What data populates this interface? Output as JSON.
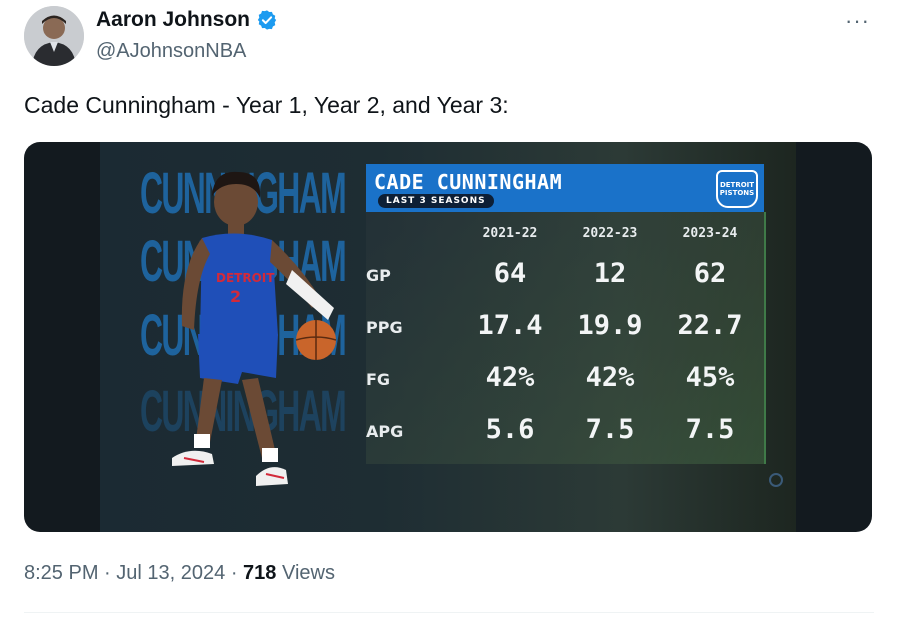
{
  "author": {
    "name": "Aaron Johnson",
    "handle": "@AJohnsonNBA",
    "verified_color": "#1d9bf0"
  },
  "tweet": {
    "text": "Cade Cunningham - Year 1, Year 2, and Year 3:",
    "more_icon": "more-horizontal-icon"
  },
  "graphic": {
    "ghost_text": [
      "CUNNINGHAM",
      "CUNNINGHAM",
      "CUNNINGHAM",
      "CUNNINGHAM"
    ],
    "jersey_text": "DETROIT",
    "jersey_number": "2",
    "title": "CADE CUNNINGHAM",
    "subtitle": "LAST 3 SEASONS",
    "team_logo_line1": "DETROIT",
    "team_logo_line2": "PISTONS",
    "accent_color": "#1a72c9"
  },
  "chart_data": {
    "type": "table",
    "title": "CADE CUNNINGHAM",
    "subtitle": "LAST 3 SEASONS",
    "columns": [
      "2021-22",
      "2022-23",
      "2023-24"
    ],
    "rows": [
      {
        "label": "GP",
        "values": [
          "64",
          "12",
          "62"
        ]
      },
      {
        "label": "PPG",
        "values": [
          "17.4",
          "19.9",
          "22.7"
        ]
      },
      {
        "label": "FG",
        "values": [
          "42%",
          "42%",
          "45%"
        ]
      },
      {
        "label": "APG",
        "values": [
          "5.6",
          "7.5",
          "7.5"
        ]
      }
    ]
  },
  "footer": {
    "time": "8:25 PM",
    "date": "Jul 13, 2024",
    "views_count": "718",
    "views_label": "Views"
  }
}
